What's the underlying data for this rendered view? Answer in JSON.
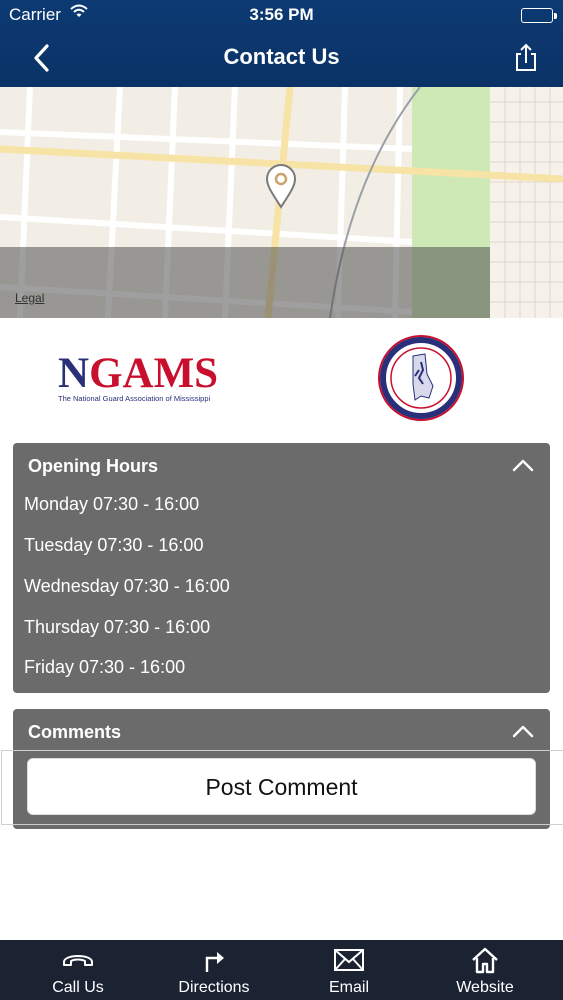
{
  "status_bar": {
    "carrier": "Carrier",
    "time": "3:56 PM"
  },
  "nav": {
    "title": "Contact Us"
  },
  "map": {
    "legal": "Legal"
  },
  "logo": {
    "name": "NGAMS",
    "name_first": "N",
    "name_rest": "GAMS",
    "tagline": "The National Guard Association of Mississippi"
  },
  "opening_hours": {
    "title": "Opening Hours",
    "rows": [
      "Monday 07:30 - 16:00",
      "Tuesday 07:30 - 16:00",
      "Wednesday 07:30 - 16:00",
      "Thursday 07:30 - 16:00",
      "Friday 07:30 - 16:00"
    ]
  },
  "comments": {
    "title": "Comments",
    "post_label": "Post Comment"
  },
  "tabbar": {
    "items": [
      {
        "label": "Call Us",
        "icon": "phone-icon"
      },
      {
        "label": "Directions",
        "icon": "directions-icon"
      },
      {
        "label": "Email",
        "icon": "envelope-icon"
      },
      {
        "label": "Website",
        "icon": "home-icon"
      }
    ]
  },
  "colors": {
    "header": "#0a3266",
    "panel": "#6b6b6b",
    "tabbar": "#1b2333",
    "logo_blue": "#2a2f7a",
    "logo_red": "#c8102e"
  }
}
